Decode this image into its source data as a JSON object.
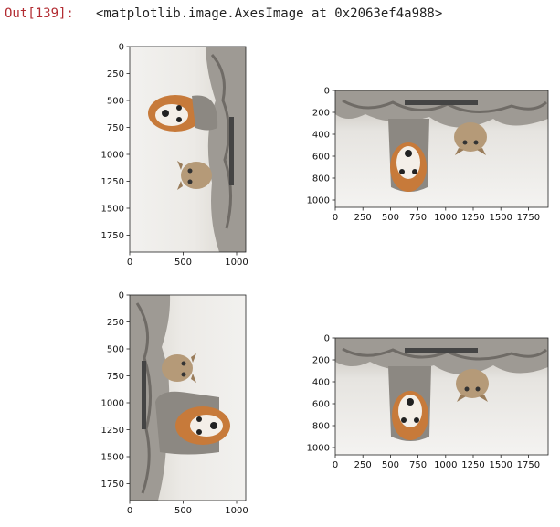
{
  "output": {
    "prompt": "Out[139]:",
    "repr": "<matplotlib.image.AxesImage at 0x2063ef4a988>"
  },
  "axes": [
    {
      "id": "a1",
      "yticks": [
        "0",
        "250",
        "500",
        "750",
        "1000",
        "1250",
        "1500",
        "1750"
      ],
      "xticks": [
        "0",
        "500",
        "1000"
      ]
    },
    {
      "id": "a2",
      "yticks": [
        "0",
        "200",
        "400",
        "600",
        "800",
        "1000"
      ],
      "xticks": [
        "0",
        "250",
        "500",
        "750",
        "1000",
        "1250",
        "1500",
        "1750"
      ]
    },
    {
      "id": "a3",
      "yticks": [
        "0",
        "250",
        "500",
        "750",
        "1000",
        "1250",
        "1500",
        "1750"
      ],
      "xticks": [
        "0",
        "500",
        "1000"
      ]
    },
    {
      "id": "a4",
      "yticks": [
        "0",
        "200",
        "400",
        "600",
        "800",
        "1000"
      ],
      "xticks": [
        "0",
        "250",
        "500",
        "750",
        "1000",
        "1250",
        "1500",
        "1750"
      ]
    }
  ]
}
